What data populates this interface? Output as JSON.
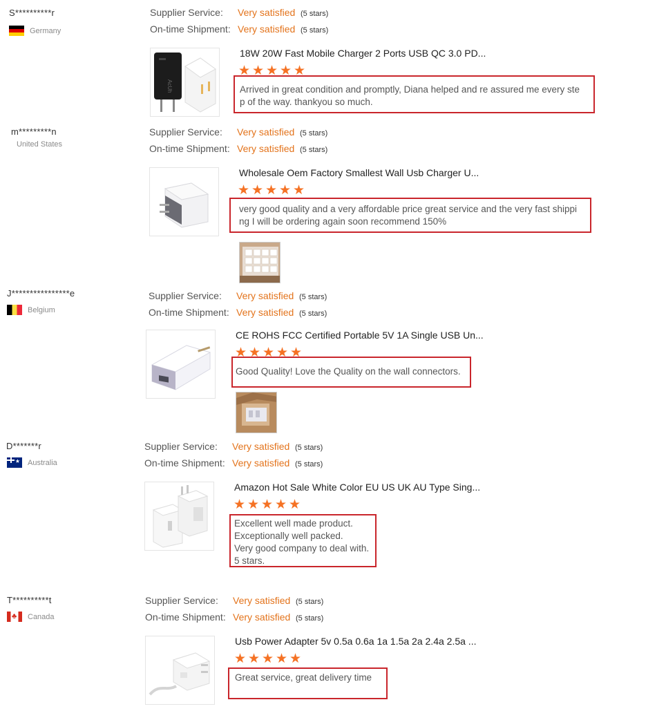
{
  "labels": {
    "supplier_service": "Supplier Service:",
    "ontime_shipment": "On-time Shipment:"
  },
  "stars_glyph": "★★★★★",
  "colors": {
    "accent": "#e3731b",
    "star": "#f57224",
    "highlight_box": "#c9252b"
  },
  "reviews": [
    {
      "user": "S**********r",
      "country": "Germany",
      "flag": "germany-flag-icon",
      "supplier_rating": "Very satisfied",
      "supplier_stars": "(5 stars)",
      "shipment_rating": "Very satisfied",
      "shipment_stars": "(5 stars)",
      "product_title": "18W 20W Fast Mobile Charger 2 Ports USB QC 3.0 PD...",
      "product_image": "black-and-white-charger-image",
      "product_rating": 5,
      "comment": "Arrived in great condition and promptly, Diana helped and re assured me every ste\np of the way. thankyou so much."
    },
    {
      "user": "m*********n",
      "country": "United States",
      "supplier_rating": "Very satisfied",
      "supplier_stars": "(5 stars)",
      "shipment_rating": "Very satisfied",
      "shipment_stars": "(5 stars)",
      "product_title": "Wholesale Oem Factory Smallest Wall Usb Charger U...",
      "product_image": "white-cube-charger-image",
      "product_rating": 5,
      "comment": "very good quality and a very affordable price great service and the very fast shippi\nng I will be ordering again soon recommend 150%",
      "photo": "review-photo-boxes"
    },
    {
      "user": "J****************e",
      "country": "Belgium",
      "flag": "belgium-flag-icon",
      "supplier_rating": "Very satisfied",
      "supplier_stars": "(5 stars)",
      "shipment_rating": "Very satisfied",
      "shipment_stars": "(5 stars)",
      "product_title": "CE ROHS FCC Certified Portable 5V 1A Single USB Un...",
      "product_image": "white-eu-plug-charger-image",
      "product_rating": 5,
      "comment": "Good Quality! Love the Quality on the wall connectors.",
      "photo": "review-photo-package"
    },
    {
      "user": "D*******r",
      "country": "Australia",
      "flag": "australia-flag-icon",
      "supplier_rating": "Very satisfied",
      "supplier_stars": "(5 stars)",
      "shipment_rating": "Very satisfied",
      "shipment_stars": "(5 stars)",
      "product_title": "Amazon Hot Sale White Color EU US UK AU Type Sing...",
      "product_image": "white-adapter-set-image",
      "product_rating": 5,
      "comment": "Excellent well made product.\nExceptionally well packed.\nVery good company to deal with.\n5 stars."
    },
    {
      "user": "T**********t",
      "country": "Canada",
      "flag": "canada-flag-icon",
      "supplier_rating": "Very satisfied",
      "supplier_stars": "(5 stars)",
      "shipment_rating": "Very satisfied",
      "shipment_stars": "(5 stars)",
      "product_title": "Usb Power Adapter 5v 0.5a 0.6a 1a 1.5a 2a 2.4a 2.5a ...",
      "product_image": "white-us-plug-adapter-image",
      "product_rating": 5,
      "comment": "Great service, great delivery time"
    }
  ]
}
